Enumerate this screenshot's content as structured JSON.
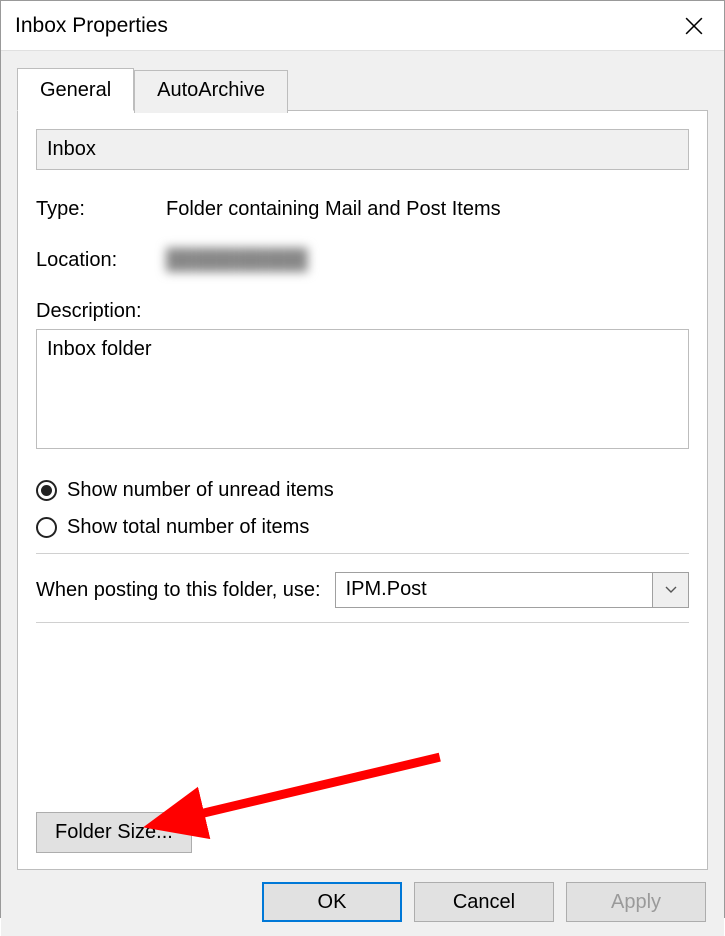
{
  "window": {
    "title": "Inbox Properties"
  },
  "tabs": {
    "general": "General",
    "autoarchive": "AutoArchive"
  },
  "general": {
    "folder_name": "Inbox",
    "type_label": "Type:",
    "type_value": "Folder containing Mail and Post Items",
    "location_label": "Location:",
    "location_value": "██████████",
    "description_label": "Description:",
    "description_value": "Inbox folder",
    "radio_unread": "Show number of unread items",
    "radio_total": "Show total number of items",
    "posting_label": "When posting to this folder, use:",
    "posting_value": "IPM.Post",
    "folder_size_btn": "Folder Size..."
  },
  "buttons": {
    "ok": "OK",
    "cancel": "Cancel",
    "apply": "Apply"
  },
  "annotation": {
    "arrow": "red-arrow-pointing-to-folder-size"
  }
}
